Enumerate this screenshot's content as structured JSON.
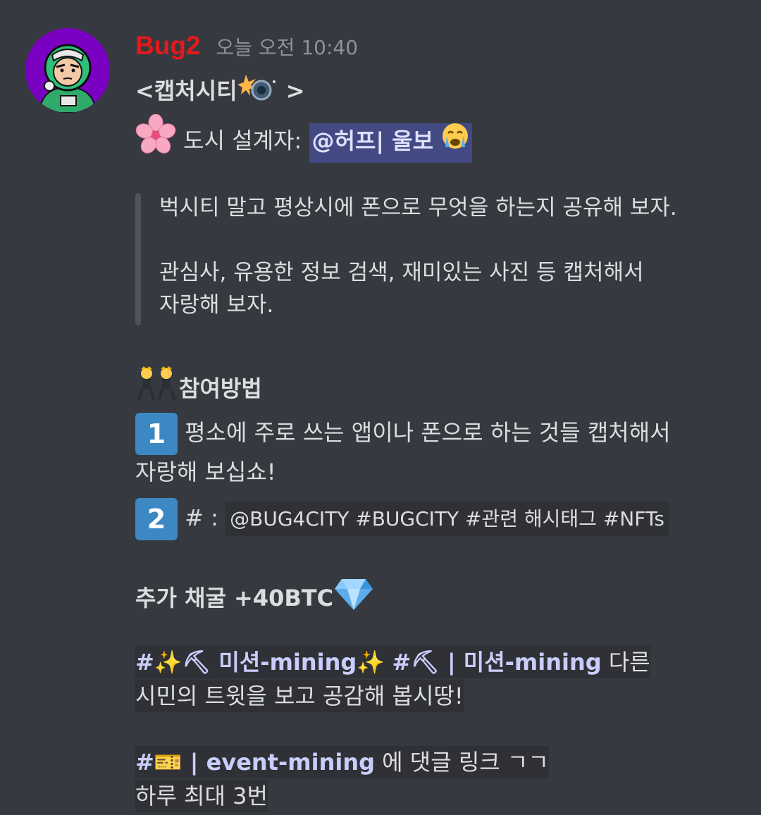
{
  "message": {
    "author": "Bug2",
    "timestamp": "오늘 오전 10:40",
    "title": "<캡처시티",
    "title_end": " >",
    "designer_label": " 도시 설계자: ",
    "designer_mention": "@허프| 울보",
    "quote": {
      "line1": "벅시티 말고 평상시에 폰으로 무엇을 하는지 공유해 보자.",
      "line2": "관심사, 유용한 정보 검색, 재미있는 사진 등 캡처해서",
      "line3": "자랑해 보자."
    },
    "participation_heading": "참여방법",
    "step1": {
      "number": "1",
      "text_line1": " 평소에 주로 쓰는 앱이나 폰으로 하는 것들 캡처해서",
      "text_line2": "자랑해 보십쇼!"
    },
    "step2": {
      "number": "2",
      "prefix": " # : ",
      "hashtags": "@BUG4CITY #BUGCITY #관련 해시태그 #NFTs"
    },
    "reward": "추가 채굴 +40BTC",
    "mission": {
      "channel1": "#✨⛏ 미션-mining✨",
      "channel2": "#⛏ | 미션-mining",
      "text_line1": "  다른",
      "text_line2": "시민의 트윗을 보고 공감해 봅시땅!"
    },
    "event": {
      "channel": "#🎫 | event-mining",
      "text_line1": "  에 댓글 링크 ㄱㄱ",
      "text_line2": "하루 최대 3번"
    }
  },
  "colors": {
    "background": "#36393f",
    "username": "#e3191c",
    "mention_bg": "#4e5382",
    "number_box": "#3b88c3",
    "code_bg": "#2f3136"
  }
}
